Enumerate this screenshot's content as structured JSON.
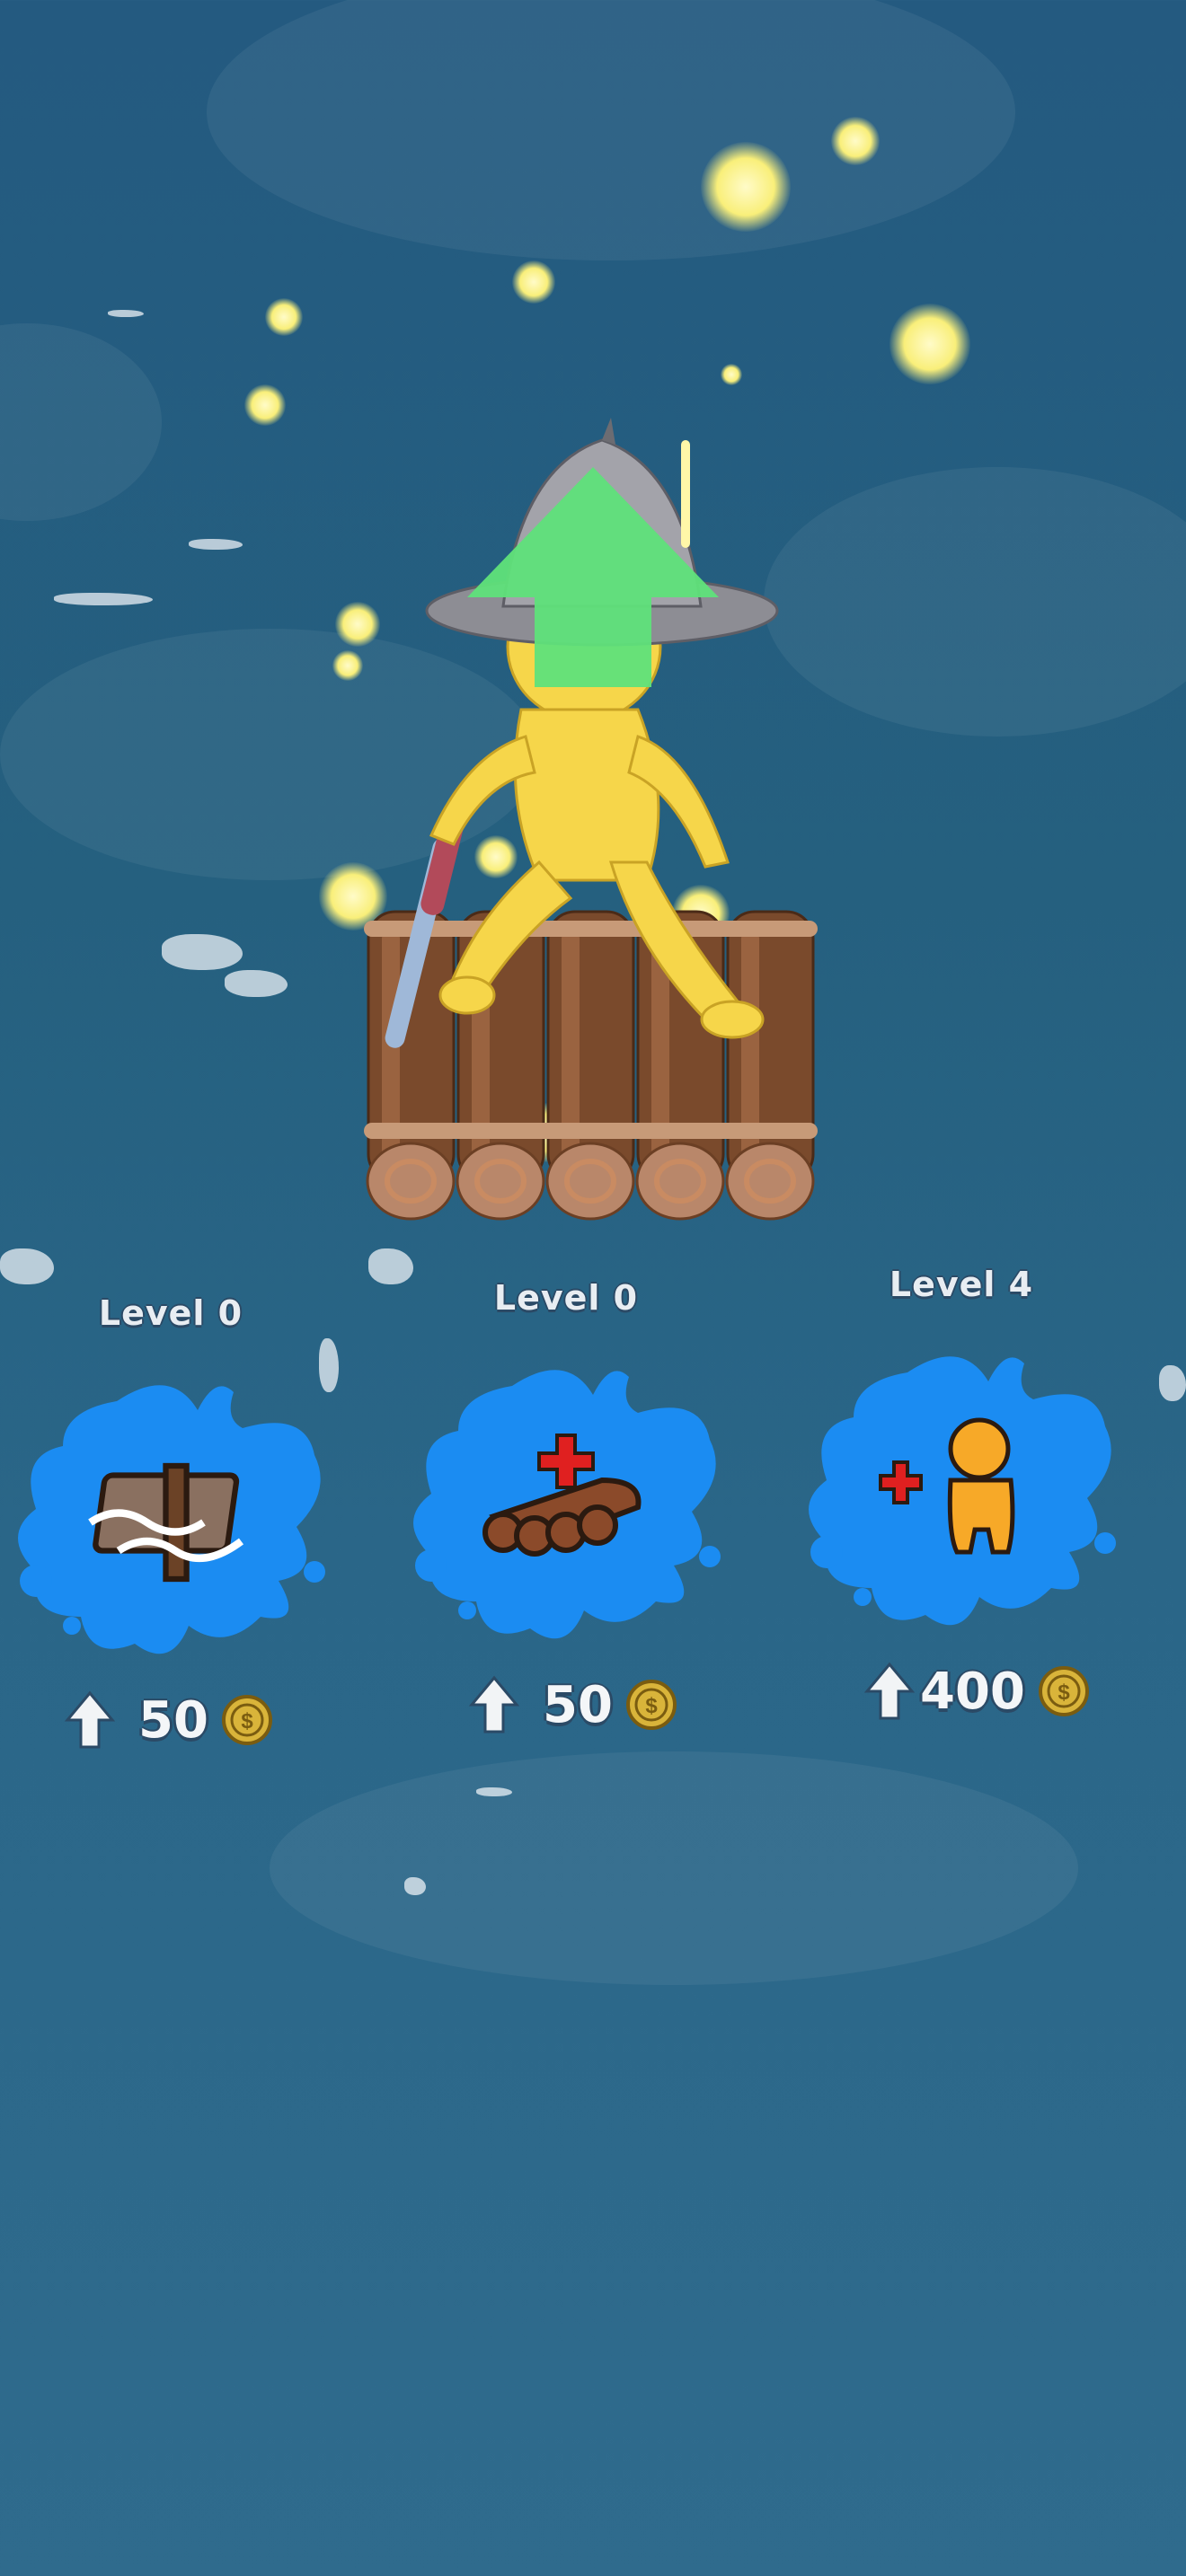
{
  "upgrades": [
    {
      "level": "Level 0",
      "price": "50",
      "icon": "raft-repair-icon"
    },
    {
      "level": "Level 0",
      "price": "50",
      "icon": "add-logs-icon"
    },
    {
      "level": "Level 4",
      "price": "400",
      "icon": "add-crew-icon"
    }
  ],
  "colors": {
    "ocean": "#25607f",
    "splash": "#1b8cf2",
    "arrow": "#5fe27a",
    "character": "#f6d64a",
    "coin": "#d9b43a"
  }
}
